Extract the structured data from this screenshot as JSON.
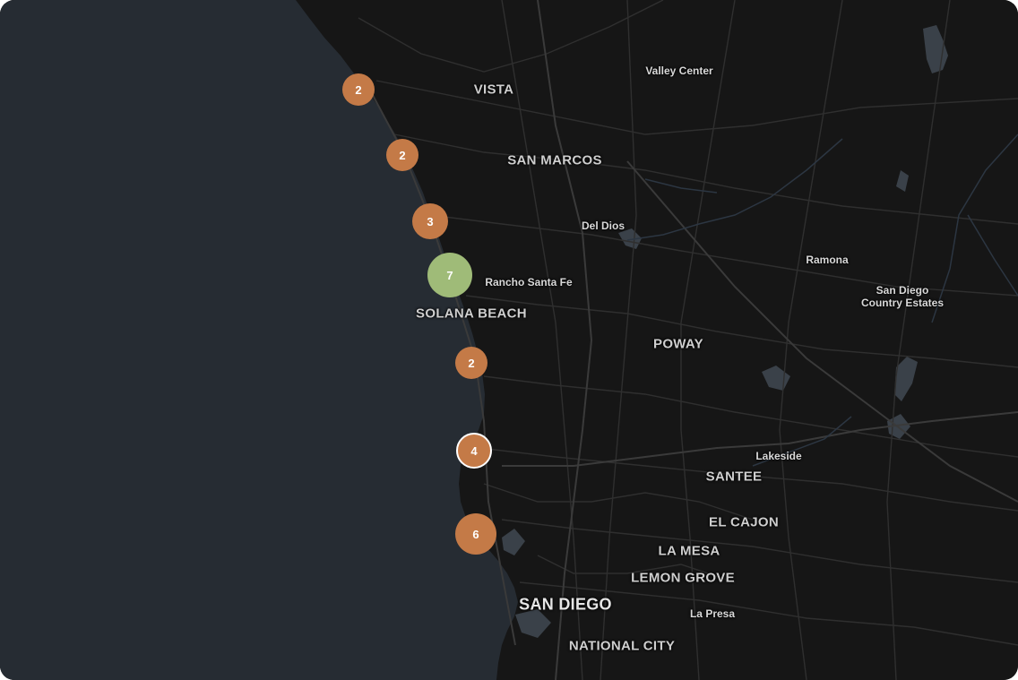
{
  "map": {
    "colors": {
      "ocean": "#262c33",
      "land": "#161616",
      "road": "#2f2f2f",
      "water_inland": "#3a4149",
      "cluster_orange": "#c47a47",
      "cluster_green": "#9fbb78"
    },
    "places": {
      "vista": "VISTA",
      "valley_center": "Valley Center",
      "san_marcos": "SAN MARCOS",
      "del_dios": "Del Dios",
      "ramona": "Ramona",
      "rancho_santa_fe": "Rancho Santa Fe",
      "san_diego_country_estates_1": "San Diego",
      "san_diego_country_estates_2": "Country Estates",
      "solana_beach": "SOLANA BEACH",
      "poway": "POWAY",
      "lakeside": "Lakeside",
      "santee": "SANTEE",
      "el_cajon": "EL CAJON",
      "la_mesa": "LA MESA",
      "lemon_grove": "LEMON GROVE",
      "san_diego": "SAN DIEGO",
      "la_presa": "La Presa",
      "national_city": "NATIONAL CITY"
    },
    "clusters": [
      {
        "count": "2",
        "color": "orange",
        "selected": false
      },
      {
        "count": "2",
        "color": "orange",
        "selected": false
      },
      {
        "count": "3",
        "color": "orange",
        "selected": false
      },
      {
        "count": "7",
        "color": "green",
        "selected": false
      },
      {
        "count": "2",
        "color": "orange",
        "selected": false
      },
      {
        "count": "4",
        "color": "orange",
        "selected": true
      },
      {
        "count": "6",
        "color": "orange",
        "selected": false
      }
    ]
  }
}
